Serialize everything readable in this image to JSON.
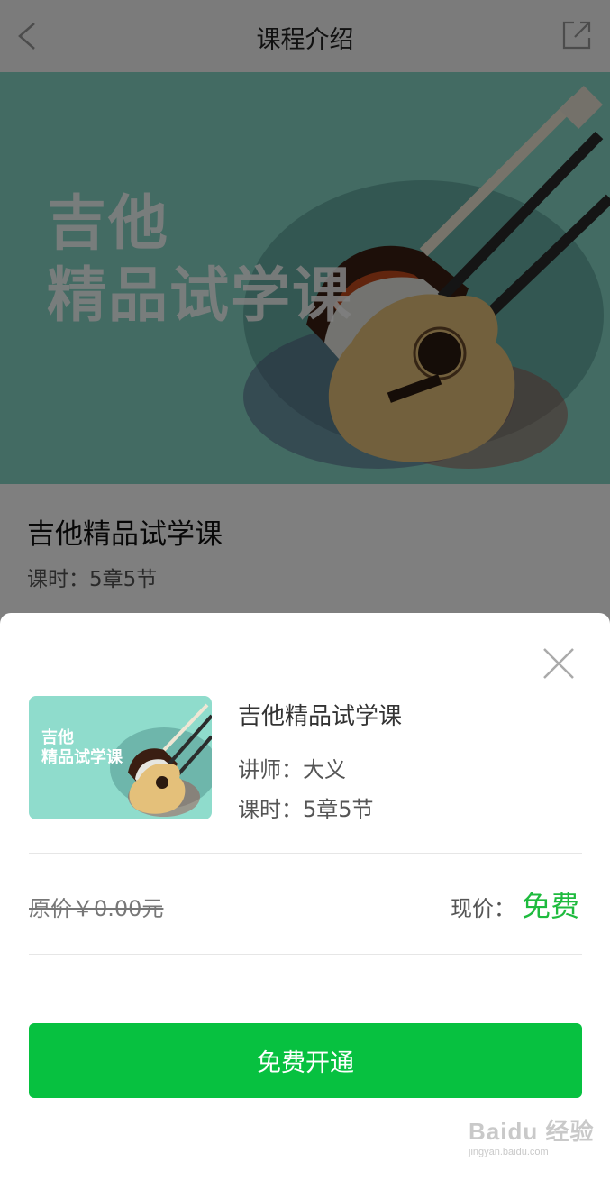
{
  "navbar": {
    "title": "课程介绍",
    "back_icon": "chevron-left-icon",
    "share_icon": "share-external-icon"
  },
  "banner": {
    "line1": "吉他",
    "line2": "精品试学课"
  },
  "course": {
    "title": "吉他精品试学课",
    "lessons": "课时：5章5节"
  },
  "sheet": {
    "close_icon": "close-icon",
    "thumb_line1": "吉他",
    "thumb_line2": "精品试学课",
    "title": "吉他精品试学课",
    "teacher": "讲师：大义",
    "lessons": "课时：5章5节",
    "original_price": "原价￥0.00元",
    "current_price_label": "现价：",
    "current_price_value": "免费",
    "open_button": "免费开通"
  },
  "watermark": {
    "brand": "Baidu 经验",
    "url": "jingyan.baidu.com"
  },
  "colors": {
    "accent_green": "#07c140",
    "price_green": "#1ebb3e",
    "banner_bg": "#86d6c6"
  }
}
